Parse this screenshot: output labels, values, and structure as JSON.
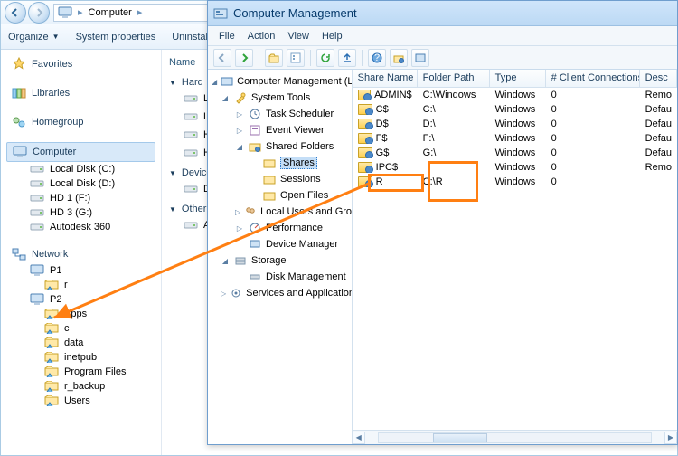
{
  "explorer": {
    "breadcrumb": {
      "root_icon": "computer",
      "segment": "Computer",
      "chev": "▸"
    },
    "toolbar": {
      "organize": "Organize",
      "sys_props": "System properties",
      "uninstall": "Uninstall"
    },
    "sidebar": {
      "favorites": "Favorites",
      "libraries": "Libraries",
      "homegroup": "Homegroup",
      "computer": "Computer",
      "drives": [
        "Local Disk (C:)",
        "Local Disk (D:)",
        "HD 1 (F:)",
        "HD 3 (G:)",
        "Autodesk 360"
      ],
      "network": "Network",
      "net_nodes": [
        {
          "name": "P1",
          "children": [
            "r"
          ]
        },
        {
          "name": "P2",
          "children": [
            "Apps",
            "c",
            "data",
            "inetpub",
            "Program Files",
            "r_backup",
            "Users"
          ]
        }
      ]
    },
    "content": {
      "name_col": "Name",
      "groups": [
        {
          "label": "Hard",
          "items": [
            "Loca",
            "Loca",
            "HD",
            "HD"
          ]
        },
        {
          "label": "Device",
          "items": [
            "DVD"
          ]
        },
        {
          "label": "Other",
          "items": [
            "Auto"
          ]
        }
      ]
    }
  },
  "mmc": {
    "title": "Computer Management",
    "menu": [
      "File",
      "Action",
      "View",
      "Help"
    ],
    "tree": {
      "root": "Computer Management (Local)",
      "system_tools": "System Tools",
      "task_sched": "Task Scheduler",
      "event_viewer": "Event Viewer",
      "shared_folders": "Shared Folders",
      "shares": "Shares",
      "sessions": "Sessions",
      "open_files": "Open Files",
      "lusrmgr": "Local Users and Groups",
      "perf": "Performance",
      "devmgr": "Device Manager",
      "storage": "Storage",
      "diskmgmt": "Disk Management",
      "services_apps": "Services and Applications"
    },
    "list": {
      "columns": {
        "name": "Share Name",
        "folder": "Folder Path",
        "type": "Type",
        "conn": "# Client Connections",
        "desc": "Desc"
      },
      "rows": [
        {
          "name": "ADMIN$",
          "folder": "C:\\Windows",
          "type": "Windows",
          "conn": "0",
          "desc": "Remo"
        },
        {
          "name": "C$",
          "folder": "C:\\",
          "type": "Windows",
          "conn": "0",
          "desc": "Defau"
        },
        {
          "name": "D$",
          "folder": "D:\\",
          "type": "Windows",
          "conn": "0",
          "desc": "Defau"
        },
        {
          "name": "F$",
          "folder": "F:\\",
          "type": "Windows",
          "conn": "0",
          "desc": "Defau"
        },
        {
          "name": "G$",
          "folder": "G:\\",
          "type": "Windows",
          "conn": "0",
          "desc": "Defau"
        },
        {
          "name": "IPC$",
          "folder": "",
          "type": "Windows",
          "conn": "0",
          "desc": "Remo"
        },
        {
          "name": "R",
          "folder": "C:\\R",
          "type": "Windows",
          "conn": "0",
          "desc": ""
        }
      ]
    }
  }
}
